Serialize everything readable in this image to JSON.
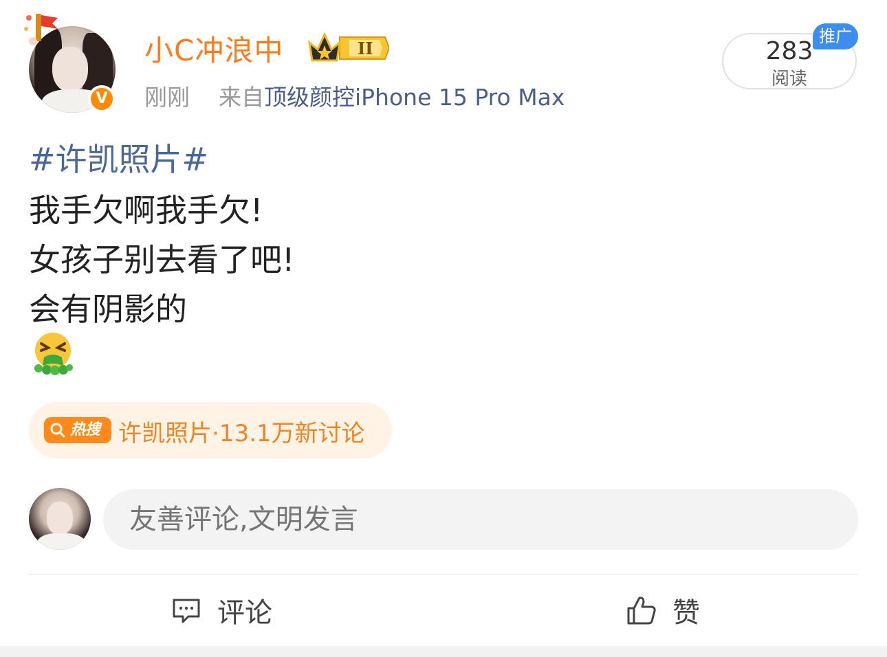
{
  "header": {
    "username": "小C冲浪中",
    "verified_badge": "V",
    "time": "刚刚",
    "source_prefix": "来自",
    "source_name": "顶级颜控iPhone 15 Pro Max",
    "read_count": "283",
    "read_label": "阅读",
    "promo_badge": "推广"
  },
  "post": {
    "hashtag": "#许凯照片#",
    "lines": [
      "我手欠啊我手欠!",
      "女孩子别去看了吧!",
      "会有阴影的"
    ],
    "emoji": "vomit-emoji-icon"
  },
  "hot_search": {
    "tag_label": "热搜",
    "topic": "许凯照片",
    "separator": "·",
    "stat": "13.1万新讨论"
  },
  "composer": {
    "placeholder": "友善评论,文明发言"
  },
  "actions": {
    "comment_label": "评论",
    "like_label": "赞"
  },
  "colors": {
    "username": "#ff7a1a",
    "source_link": "#4c5d86",
    "hashtag": "#4a6796",
    "hot_accent": "#ff8a1a",
    "hot_bg": "#fff3e6",
    "promo": "#3b8df0"
  }
}
